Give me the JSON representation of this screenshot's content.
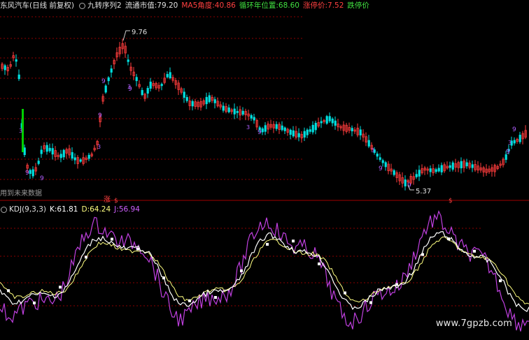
{
  "header": {
    "stock": "东风汽车(日线 前复权)",
    "indicator": "九转序列2",
    "circ_label": "流通市值:",
    "circ_value": "79.20",
    "ma5_label": "MA5角度:",
    "ma5_value": "40.86",
    "ring_label": "循环年位置:",
    "ring_value": "68.60",
    "limit_up_label": "涨停价:",
    "limit_up_value": "7.52",
    "limit_down_label": "跌停价"
  },
  "price_chart": {
    "high_label": "9.76",
    "low_label": "5.37",
    "warning": "用到未来数据",
    "marker_zhang": "涨",
    "marker_s1": "$",
    "marker_s2": "$"
  },
  "kdj": {
    "name": "KDJ(9,3,3)",
    "k_label": "K:",
    "k_value": "61.81",
    "d_label": "D:",
    "d_value": "64.24",
    "j_label": "J:",
    "j_value": "56.94"
  },
  "watermark": "www.7gpzb.com",
  "colors": {
    "up": "#ff3c3c",
    "down": "#00e0e0",
    "grid": "#8b0000",
    "k_line": "#ffffff",
    "d_line": "#ffff80",
    "j_line": "#c040e0",
    "nine_label": "#b060ff",
    "green_bar": "#00d000"
  },
  "chart_data": {
    "type": "candlestick",
    "high_marker": 9.76,
    "low_marker": 5.37,
    "kdj_last": {
      "K": 61.81,
      "D": 64.24,
      "J": 56.94
    }
  }
}
